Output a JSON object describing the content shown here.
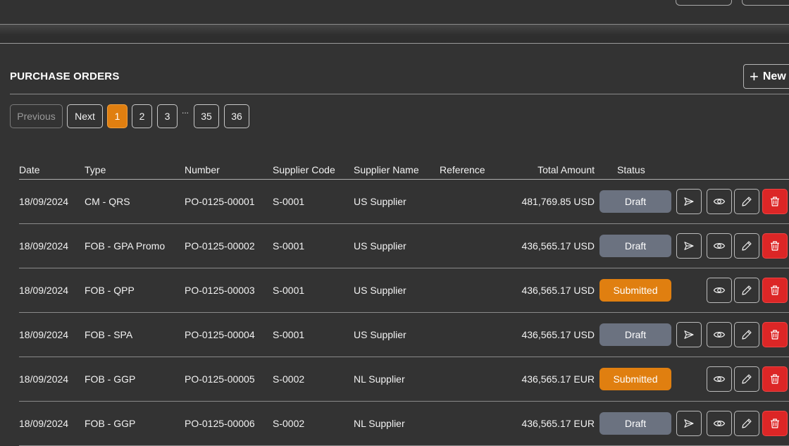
{
  "section": {
    "title": "PURCHASE ORDERS",
    "new_label": "New"
  },
  "pagination": {
    "previous": "Previous",
    "next": "Next",
    "pages": [
      "1",
      "2",
      "3",
      "35",
      "36"
    ],
    "ellipsis": "...",
    "current": "1"
  },
  "table": {
    "headers": {
      "date": "Date",
      "type": "Type",
      "number": "Number",
      "supplier_code": "Supplier Code",
      "supplier_name": "Supplier Name",
      "reference": "Reference",
      "total_amount": "Total Amount",
      "status": "Status"
    },
    "rows": [
      {
        "date": "18/09/2024",
        "type": "CM - QRS",
        "number": "PO-0125-00001",
        "supplier_code": "S-0001",
        "supplier_name": "US Supplier",
        "reference": "",
        "total_amount": "481,769.85 USD",
        "status": "Draft"
      },
      {
        "date": "18/09/2024",
        "type": "FOB - GPA Promo",
        "number": "PO-0125-00002",
        "supplier_code": "S-0001",
        "supplier_name": "US Supplier",
        "reference": "",
        "total_amount": "436,565.17 USD",
        "status": "Draft"
      },
      {
        "date": "18/09/2024",
        "type": "FOB - QPP",
        "number": "PO-0125-00003",
        "supplier_code": "S-0001",
        "supplier_name": "US Supplier",
        "reference": "",
        "total_amount": "436,565.17 USD",
        "status": "Submitted"
      },
      {
        "date": "18/09/2024",
        "type": "FOB - SPA",
        "number": "PO-0125-00004",
        "supplier_code": "S-0001",
        "supplier_name": "US Supplier",
        "reference": "",
        "total_amount": "436,565.17 USD",
        "status": "Draft"
      },
      {
        "date": "18/09/2024",
        "type": "FOB - GGP",
        "number": "PO-0125-00005",
        "supplier_code": "S-0002",
        "supplier_name": "NL Supplier",
        "reference": "",
        "total_amount": "436,565.17 EUR",
        "status": "Submitted"
      },
      {
        "date": "18/09/2024",
        "type": "FOB - GGP",
        "number": "PO-0125-00006",
        "supplier_code": "S-0002",
        "supplier_name": "NL Supplier",
        "reference": "",
        "total_amount": "436,565.17 EUR",
        "status": "Draft"
      }
    ]
  },
  "row_actions": [
    "send-icon",
    "eye-icon",
    "pencil-icon",
    "trash-icon"
  ],
  "colors": {
    "accent": "#e07f10",
    "draft": "#6b7280",
    "danger": "#dc2626",
    "background": "#333333"
  }
}
